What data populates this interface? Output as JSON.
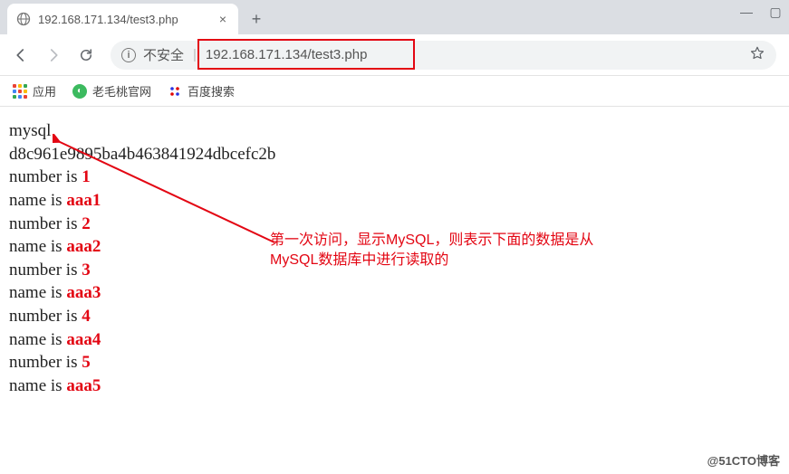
{
  "tab": {
    "title": "192.168.171.134/test3.php",
    "close_glyph": "×"
  },
  "window": {
    "minimize": "—",
    "maximize": "▢"
  },
  "toolbar": {
    "insecure_label": "不安全",
    "url": "192.168.171.134/test3.php"
  },
  "bookmarks": {
    "apps": "应用",
    "item1": "老毛桃官网",
    "item2": "百度搜索"
  },
  "content": {
    "source": "mysql",
    "hash": "d8c961e9895ba4b463841924dbcefc2b",
    "number_prefix": "number is ",
    "name_prefix": "name is ",
    "rows": [
      {
        "number": "1",
        "name": "aaa1"
      },
      {
        "number": "2",
        "name": "aaa2"
      },
      {
        "number": "3",
        "name": "aaa3"
      },
      {
        "number": "4",
        "name": "aaa4"
      },
      {
        "number": "5",
        "name": "aaa5"
      }
    ]
  },
  "annotation": {
    "line1": "第一次访问，显示MySQL，则表示下面的数据是从",
    "line2": "MySQL数据库中进行读取的"
  },
  "watermark": "@51CTO博客"
}
